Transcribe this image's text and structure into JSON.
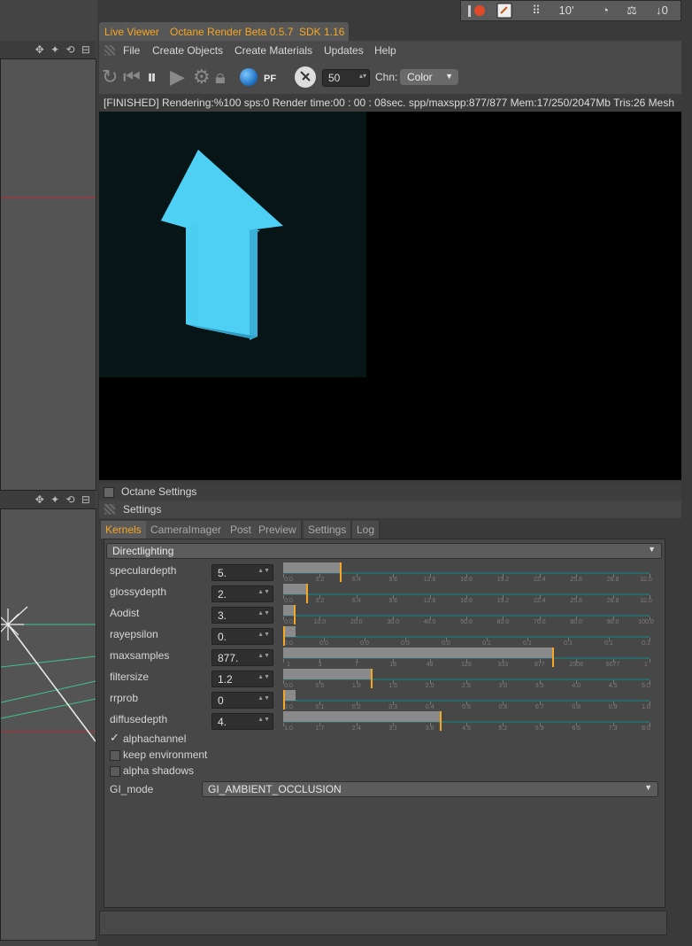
{
  "top_toolbar": {
    "tools": [
      "shape-icon",
      "refresh-icon",
      "grid-icon",
      "clock-icon",
      "bulb-icon",
      "scale-icon",
      "arrow-icon"
    ],
    "label_1": "10'",
    "label_2": "0"
  },
  "left_viewports": {
    "icons": "✥ ✦ ⟲ ⊟"
  },
  "live_viewer": {
    "tab_title": "Live Viewer",
    "tab_version": "Octane Render Beta 0.5.7",
    "tab_sdk": "SDK 1.16",
    "menu": [
      "File",
      "Create Objects",
      "Create Materials",
      "Updates",
      "Help"
    ],
    "spin_value": "50",
    "chn_label": "Chn:",
    "chn_value": "Color",
    "status": "[FINISHED]  Rendering:%100 sps:0 Render time:00 : 00 : 08sec. spp/maxspp:877/877 Mem:17/250/2047Mb Tris:26 Mesh"
  },
  "octane_settings": {
    "title": "Octane Settings",
    "settings_title": "Settings",
    "tabs": [
      "Kernels",
      "CameraImager",
      "Post",
      "Preview",
      "Settings",
      "Log"
    ],
    "kernel": "Directlighting",
    "params": [
      {
        "label": "speculardepth",
        "value": "5.",
        "fraction": 0.155,
        "ticks": [
          "0.0",
          "3.2",
          "6.4",
          "9.6",
          "12.8",
          "16.0",
          "19.2",
          "22.4",
          "25.6",
          "28.8",
          "32.0"
        ]
      },
      {
        "label": "glossydepth",
        "value": "2.",
        "fraction": 0.063,
        "ticks": [
          "0.0",
          "3.2",
          "6.4",
          "9.6",
          "12.8",
          "16.0",
          "19.2",
          "22.4",
          "25.6",
          "28.8",
          "32.0"
        ]
      },
      {
        "label": "Aodist",
        "value": "3.",
        "fraction": 0.03,
        "ticks": [
          "0.0",
          "10.0",
          "20.0",
          "30.0",
          "40.0",
          "50.0",
          "60.0",
          "70.0",
          "80.0",
          "90.0",
          "100.0"
        ]
      },
      {
        "label": "rayepsilon",
        "value": "0.",
        "fraction": 0.0,
        "ticks": [
          "0.0",
          "0.0",
          "0.0",
          "0.0",
          "0.0",
          "0.1",
          "0.1",
          "0.1",
          "0.1",
          "0.1"
        ]
      },
      {
        "label": "maxsamples",
        "value": "877.",
        "fraction": 0.735,
        "ticks": [
          "1",
          "3",
          "7",
          "18",
          "48",
          "126",
          "333",
          "877",
          "2308",
          "6077",
          "1"
        ]
      },
      {
        "label": "filtersize",
        "value": "1.2",
        "fraction": 0.24,
        "ticks": [
          "0.0",
          "0.5",
          "1.0",
          "1.5",
          "2.0",
          "2.5",
          "3.0",
          "3.5",
          "4.0",
          "4.5",
          "5.0"
        ]
      },
      {
        "label": "rrprob",
        "value": "0",
        "fraction": 0.0,
        "ticks": [
          "0.0",
          "0.1",
          "0.2",
          "0.3",
          "0.4",
          "0.5",
          "0.6",
          "0.7",
          "0.8",
          "0.9",
          "1.0"
        ]
      },
      {
        "label": "diffusedepth",
        "value": "4.",
        "fraction": 0.428,
        "ticks": [
          "1.0",
          "1.7",
          "2.4",
          "3.1",
          "3.8",
          "4.5",
          "5.2",
          "5.9",
          "6.6",
          "7.3",
          "8.0"
        ]
      }
    ],
    "checkboxes": [
      {
        "label": "alphachannel",
        "checked": true
      },
      {
        "label": "keep environment",
        "checked": false
      },
      {
        "label": "alpha shadows",
        "checked": false
      }
    ],
    "gi_mode_label": "GI_mode",
    "gi_mode_value": "GI_AMBIENT_OCCLUSION"
  },
  "colors": {
    "accent": "#f5a623",
    "arrow": "#4ccdf2",
    "track": "#2c6a6a"
  }
}
